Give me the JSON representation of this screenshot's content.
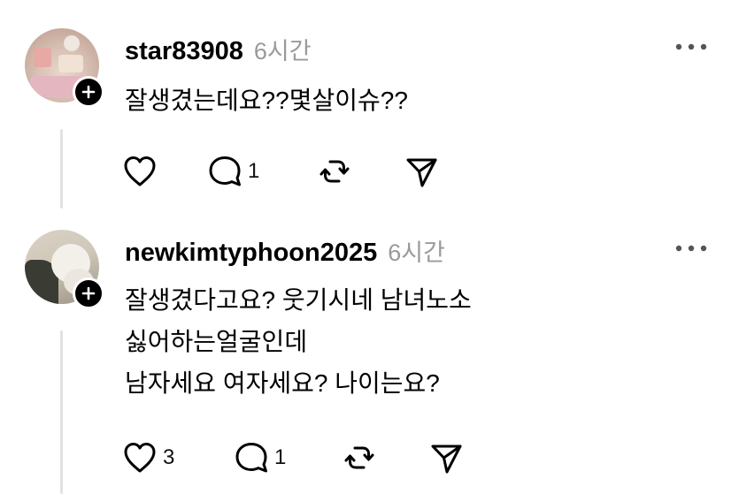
{
  "comments": [
    {
      "username": "star83908",
      "time": "6시간",
      "lines": [
        "잘생겼는데요??몇살이슈??"
      ],
      "like_count": "",
      "reply_count": "1"
    },
    {
      "username": "newkimtyphoon2025",
      "time": "6시간",
      "lines": [
        "잘생겼다고요? 웃기시네 남녀노소",
        "싫어하는얼굴인데",
        "남자세요 여자세요? 나이는요?"
      ],
      "like_count": "3",
      "reply_count": "1"
    }
  ],
  "icons": {
    "follow": "plus-icon",
    "more": "more-horizontal-icon",
    "like": "heart-icon",
    "reply": "comment-bubble-icon",
    "repost": "repost-icon",
    "share": "send-icon"
  },
  "colors": {
    "text": "#000000",
    "secondary": "#9a9a9a",
    "thread_line": "#e2e2e2"
  }
}
